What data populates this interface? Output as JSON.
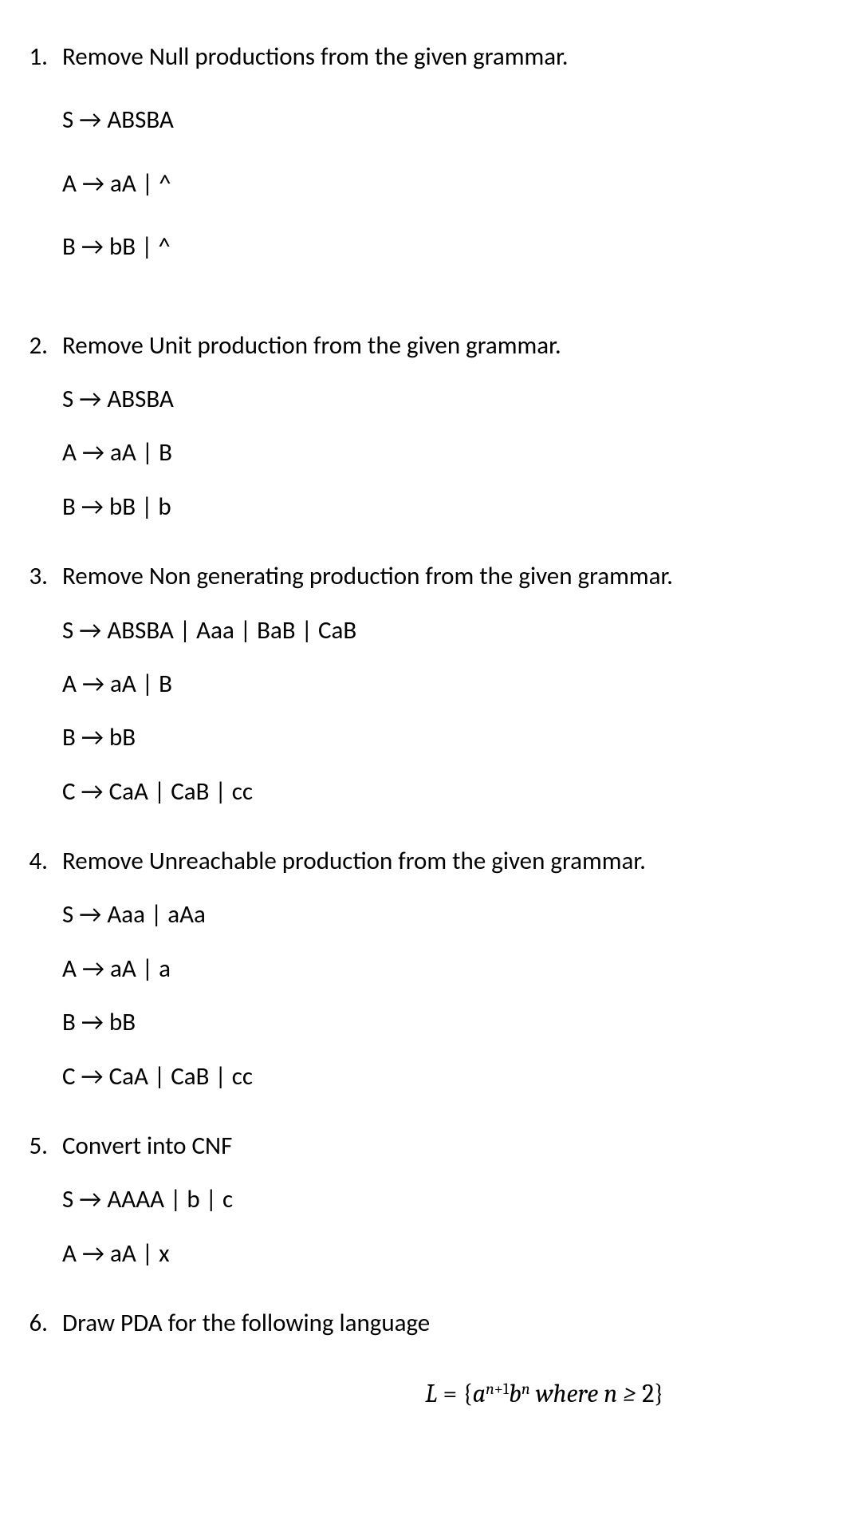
{
  "questions": [
    {
      "num": "1.",
      "title": "Remove Null productions from the given grammar.",
      "tight": false,
      "rules": [
        "S → ABSBA",
        "A → aA | ^",
        "B → bB | ^"
      ]
    },
    {
      "num": "2.",
      "title": "Remove Unit production from the given grammar.",
      "tight": true,
      "rules": [
        "S → ABSBA",
        "A → aA | B",
        "B → bB | b"
      ]
    },
    {
      "num": "3.",
      "title": "Remove Non generating production from the given grammar.",
      "tight": true,
      "rules": [
        "S → ABSBA | Aaa | BaB | CaB",
        "A → aA | B",
        "B → bB",
        "C → CaA | CaB | cc"
      ]
    },
    {
      "num": "4.",
      "title": "Remove Unreachable production from the given grammar.",
      "tight": true,
      "rules": [
        "S →  Aaa | aAa",
        "A → aA | a",
        "B → bB",
        "C → CaA | CaB | cc"
      ]
    },
    {
      "num": "5.",
      "title": "Convert into CNF",
      "tight": true,
      "rules": [
        "S → AAAA | b | c",
        "A → aA | x"
      ]
    },
    {
      "num": "6.",
      "title": "Draw PDA for the following language",
      "tight": true,
      "rules": []
    }
  ],
  "formula": {
    "L": "L",
    "eq": " = {",
    "a": "a",
    "exp1_a": "n",
    "exp1_b": "+1",
    "b": "b",
    "exp2": "n",
    "where": " where n ≥ ",
    "two": "2",
    "close": "}"
  }
}
